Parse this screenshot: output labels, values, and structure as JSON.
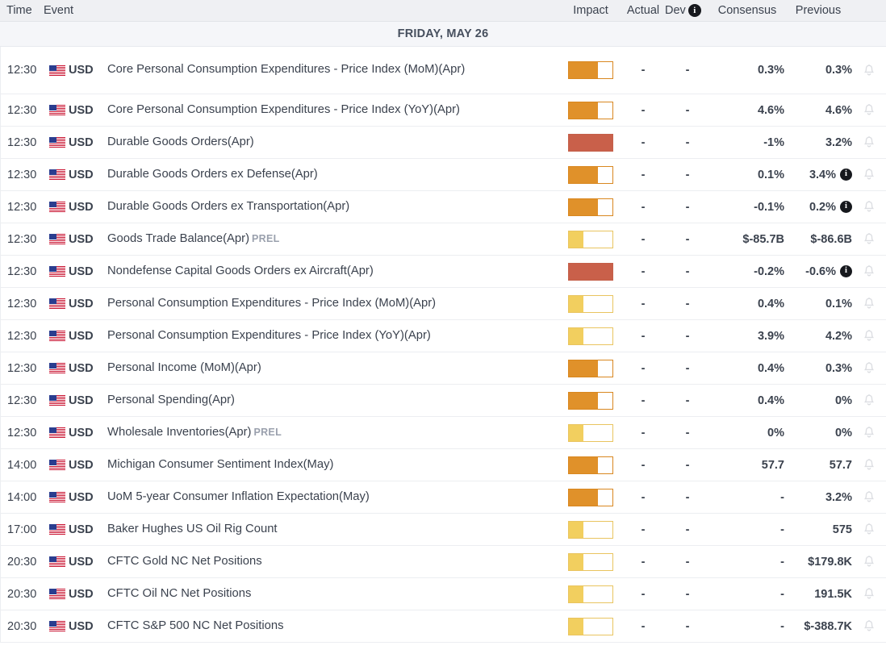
{
  "header": {
    "time": "Time",
    "event": "Event",
    "impact": "Impact",
    "actual": "Actual",
    "dev": "Dev",
    "dev_info_icon": "info-icon",
    "consensus": "Consensus",
    "previous": "Previous"
  },
  "date_group": {
    "label": "FRIDAY, MAY 26"
  },
  "colors": {
    "impact_low": "#f2cf5f",
    "impact_medium": "#e0912a",
    "impact_high": "#c9604a",
    "header_bg": "#eff0f3",
    "date_bg": "#f5f6f9",
    "text": "#3b424e",
    "muted": "#9aa0ad"
  },
  "icons": {
    "flag": "us-flag-icon",
    "bell": "bell-icon",
    "info": "info-icon"
  },
  "rows": [
    {
      "time": "12:30",
      "currency": "USD",
      "event": "Core Personal Consumption Expenditures - Price Index (MoM)(Apr)",
      "prel": "",
      "impact": "medium",
      "actual": "-",
      "dev": "-",
      "consensus": "0.3%",
      "previous": "0.3%",
      "previous_info": false,
      "tall": true
    },
    {
      "time": "12:30",
      "currency": "USD",
      "event": "Core Personal Consumption Expenditures - Price Index (YoY)(Apr)",
      "prel": "",
      "impact": "medium",
      "actual": "-",
      "dev": "-",
      "consensus": "4.6%",
      "previous": "4.6%",
      "previous_info": false,
      "tall": false
    },
    {
      "time": "12:30",
      "currency": "USD",
      "event": "Durable Goods Orders(Apr)",
      "prel": "",
      "impact": "high",
      "actual": "-",
      "dev": "-",
      "consensus": "-1%",
      "previous": "3.2%",
      "previous_info": false,
      "tall": false
    },
    {
      "time": "12:30",
      "currency": "USD",
      "event": "Durable Goods Orders ex Defense(Apr)",
      "prel": "",
      "impact": "medium",
      "actual": "-",
      "dev": "-",
      "consensus": "0.1%",
      "previous": "3.4%",
      "previous_info": true,
      "tall": false
    },
    {
      "time": "12:30",
      "currency": "USD",
      "event": "Durable Goods Orders ex Transportation(Apr)",
      "prel": "",
      "impact": "medium",
      "actual": "-",
      "dev": "-",
      "consensus": "-0.1%",
      "previous": "0.2%",
      "previous_info": true,
      "tall": false
    },
    {
      "time": "12:30",
      "currency": "USD",
      "event": "Goods Trade Balance(Apr)",
      "prel": "PREL",
      "impact": "low",
      "actual": "-",
      "dev": "-",
      "consensus": "$-85.7B",
      "previous": "$-86.6B",
      "previous_info": false,
      "tall": false
    },
    {
      "time": "12:30",
      "currency": "USD",
      "event": "Nondefense Capital Goods Orders ex Aircraft(Apr)",
      "prel": "",
      "impact": "high",
      "actual": "-",
      "dev": "-",
      "consensus": "-0.2%",
      "previous": "-0.6%",
      "previous_info": true,
      "tall": false
    },
    {
      "time": "12:30",
      "currency": "USD",
      "event": "Personal Consumption Expenditures - Price Index (MoM)(Apr)",
      "prel": "",
      "impact": "low",
      "actual": "-",
      "dev": "-",
      "consensus": "0.4%",
      "previous": "0.1%",
      "previous_info": false,
      "tall": false
    },
    {
      "time": "12:30",
      "currency": "USD",
      "event": "Personal Consumption Expenditures - Price Index (YoY)(Apr)",
      "prel": "",
      "impact": "low",
      "actual": "-",
      "dev": "-",
      "consensus": "3.9%",
      "previous": "4.2%",
      "previous_info": false,
      "tall": false
    },
    {
      "time": "12:30",
      "currency": "USD",
      "event": "Personal Income (MoM)(Apr)",
      "prel": "",
      "impact": "medium",
      "actual": "-",
      "dev": "-",
      "consensus": "0.4%",
      "previous": "0.3%",
      "previous_info": false,
      "tall": false
    },
    {
      "time": "12:30",
      "currency": "USD",
      "event": "Personal Spending(Apr)",
      "prel": "",
      "impact": "medium",
      "actual": "-",
      "dev": "-",
      "consensus": "0.4%",
      "previous": "0%",
      "previous_info": false,
      "tall": false
    },
    {
      "time": "12:30",
      "currency": "USD",
      "event": "Wholesale Inventories(Apr)",
      "prel": "PREL",
      "impact": "low",
      "actual": "-",
      "dev": "-",
      "consensus": "0%",
      "previous": "0%",
      "previous_info": false,
      "tall": false
    },
    {
      "time": "14:00",
      "currency": "USD",
      "event": "Michigan Consumer Sentiment Index(May)",
      "prel": "",
      "impact": "medium",
      "actual": "-",
      "dev": "-",
      "consensus": "57.7",
      "previous": "57.7",
      "previous_info": false,
      "tall": false
    },
    {
      "time": "14:00",
      "currency": "USD",
      "event": "UoM 5-year Consumer Inflation Expectation(May)",
      "prel": "",
      "impact": "medium",
      "actual": "-",
      "dev": "-",
      "consensus": "-",
      "previous": "3.2%",
      "previous_info": false,
      "tall": false
    },
    {
      "time": "17:00",
      "currency": "USD",
      "event": "Baker Hughes US Oil Rig Count",
      "prel": "",
      "impact": "low",
      "actual": "-",
      "dev": "-",
      "consensus": "-",
      "previous": "575",
      "previous_info": false,
      "tall": false
    },
    {
      "time": "20:30",
      "currency": "USD",
      "event": "CFTC Gold NC Net Positions",
      "prel": "",
      "impact": "low",
      "actual": "-",
      "dev": "-",
      "consensus": "-",
      "previous": "$179.8K",
      "previous_info": false,
      "tall": false
    },
    {
      "time": "20:30",
      "currency": "USD",
      "event": "CFTC Oil NC Net Positions",
      "prel": "",
      "impact": "low",
      "actual": "-",
      "dev": "-",
      "consensus": "-",
      "previous": "191.5K",
      "previous_info": false,
      "tall": false
    },
    {
      "time": "20:30",
      "currency": "USD",
      "event": "CFTC S&P 500 NC Net Positions",
      "prel": "",
      "impact": "low",
      "actual": "-",
      "dev": "-",
      "consensus": "-",
      "previous": "$-388.7K",
      "previous_info": false,
      "tall": false
    }
  ]
}
